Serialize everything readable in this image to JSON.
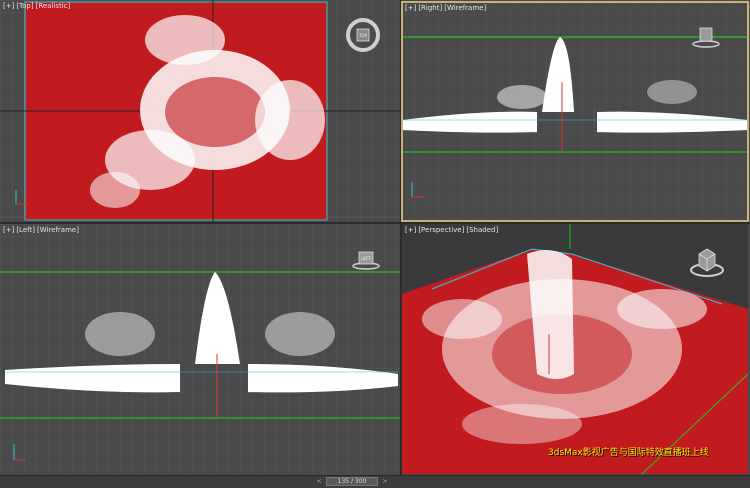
{
  "viewports": {
    "top": {
      "tag": "[+]",
      "view": "[Top]",
      "mode": "[Realistic]"
    },
    "right": {
      "tag": "[+]",
      "view": "[Right]",
      "mode": "[Wireframe]"
    },
    "left": {
      "tag": "[+]",
      "view": "[Left]",
      "mode": "[Wireframe]"
    },
    "perspective": {
      "tag": "[+]",
      "view": "[Perspective]",
      "mode": "[Shaded]"
    }
  },
  "navcube": {
    "top_label": "TOP",
    "left_label": "LEFT"
  },
  "timeline": {
    "frame_display": "135 / 300",
    "prev_symbol": "<",
    "next_symbol": ">"
  },
  "watermark": "3dsMax影视广告与国际特效直播班上线",
  "colors": {
    "viewport_bg": "#4a4a4a",
    "grid_line": "#5c5c5c",
    "grid_major": "#2f2f2f",
    "surface_red": "#c11b1f",
    "particle_white": "#ffffff",
    "bounds_green": "#24c224",
    "active_border": "#c8b27a",
    "watermark": "#ffe600"
  }
}
